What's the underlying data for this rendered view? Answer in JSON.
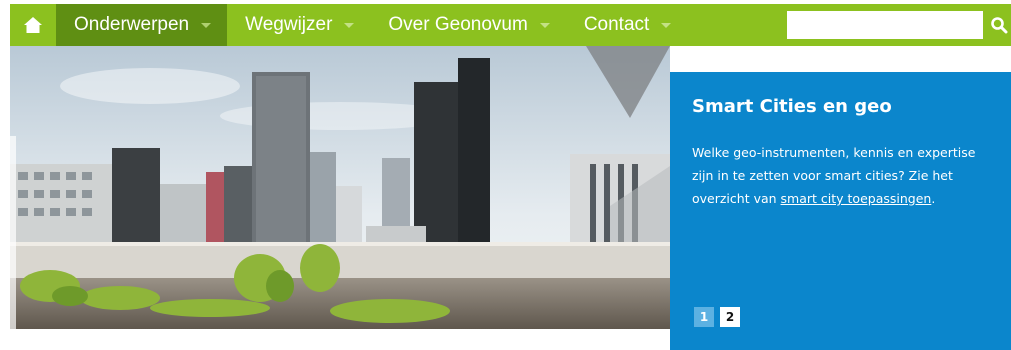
{
  "nav": {
    "home_icon": "home-icon",
    "items": [
      {
        "label": "Onderwerpen",
        "active": true
      },
      {
        "label": "Wegwijzer",
        "active": false
      },
      {
        "label": "Over Geonovum",
        "active": false
      },
      {
        "label": "Contact",
        "active": false
      }
    ],
    "search_value": "",
    "search_icon": "search-icon"
  },
  "slide": {
    "title": "Smart Cities en geo",
    "text_before": "Welke geo-instrumenten, kennis en expertise zijn in te zetten voor smart cities? Zie het overzicht van ",
    "link_text": "smart city toepassingen",
    "text_after": ".",
    "pages": [
      "1",
      "2"
    ],
    "current_page": "2"
  },
  "colors": {
    "nav_green": "#8cc11f",
    "nav_active": "#5f8f13",
    "panel_blue": "#0b86cc"
  }
}
